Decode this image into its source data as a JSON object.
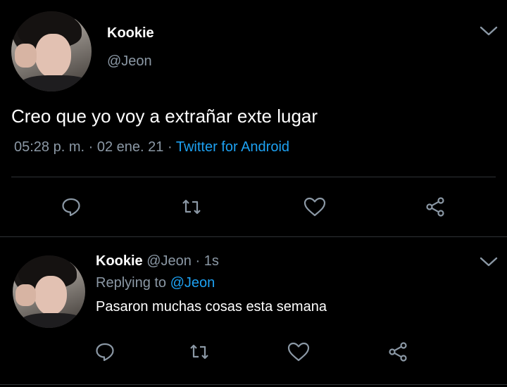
{
  "main_tweet": {
    "author_name": "Kookie",
    "author_handle": "@Jeon",
    "text": "Creo que yo voy a extrañar exte lugar",
    "time": "05:28 p. m.",
    "date": "02 ene. 21",
    "source": "Twitter for Android",
    "separator": "·"
  },
  "reply_tweet": {
    "author_name": "Kookie",
    "author_handle": "@Jeon",
    "age": "1s",
    "replying_label": "Replying to",
    "replying_to": "@Jeon",
    "text": "Pasaron muchas cosas esta semana"
  },
  "icons": {
    "chevron": "chevron-down-icon",
    "reply": "comment-icon",
    "retweet": "retweet-icon",
    "like": "heart-icon",
    "share": "share-icon"
  },
  "colors": {
    "background": "#000000",
    "text": "#ffffff",
    "secondary_text": "#8b98a5",
    "accent": "#1da1f2",
    "divider": "#2f3336",
    "icon": "#8b98a5"
  }
}
